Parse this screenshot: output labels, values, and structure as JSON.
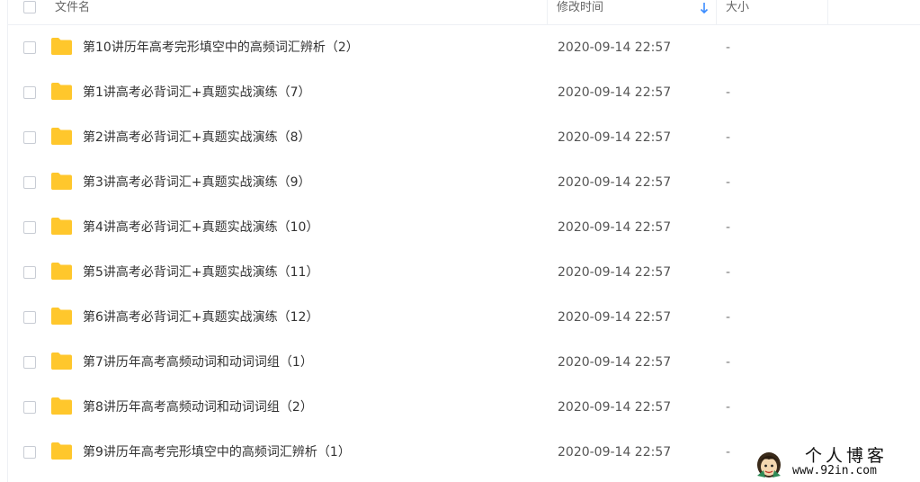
{
  "header": {
    "name_label": "文件名",
    "time_label": "修改时间",
    "size_label": "大小",
    "sort_icon": "arrow-down-icon",
    "sort_color": "#3b8cff"
  },
  "folder_icon": "folder-icon",
  "folder_color": "#ffc72c",
  "files": [
    {
      "name": "第10讲历年高考完形填空中的高频词汇辨析（2）",
      "mtime": "2020-09-14 22:57",
      "size": "-"
    },
    {
      "name": "第1讲高考必背词汇+真题实战演练（7）",
      "mtime": "2020-09-14 22:57",
      "size": "-"
    },
    {
      "name": "第2讲高考必背词汇+真题实战演练（8）",
      "mtime": "2020-09-14 22:57",
      "size": "-"
    },
    {
      "name": "第3讲高考必背词汇+真题实战演练（9）",
      "mtime": "2020-09-14 22:57",
      "size": "-"
    },
    {
      "name": "第4讲高考必背词汇+真题实战演练（10）",
      "mtime": "2020-09-14 22:57",
      "size": "-"
    },
    {
      "name": "第5讲高考必背词汇+真题实战演练（11）",
      "mtime": "2020-09-14 22:57",
      "size": "-"
    },
    {
      "name": "第6讲高考必背词汇+真题实战演练（12）",
      "mtime": "2020-09-14 22:57",
      "size": "-"
    },
    {
      "name": "第7讲历年高考高频动词和动词词组（1）",
      "mtime": "2020-09-14 22:57",
      "size": "-"
    },
    {
      "name": "第8讲历年高考高频动词和动词词组（2）",
      "mtime": "2020-09-14 22:57",
      "size": "-"
    },
    {
      "name": "第9讲历年高考完形填空中的高频词汇辨析（1）",
      "mtime": "2020-09-14 22:57",
      "size": "-"
    }
  ],
  "watermark": {
    "title": "个人博客",
    "url": "www.92in.com",
    "icon": "avatar-icon"
  }
}
